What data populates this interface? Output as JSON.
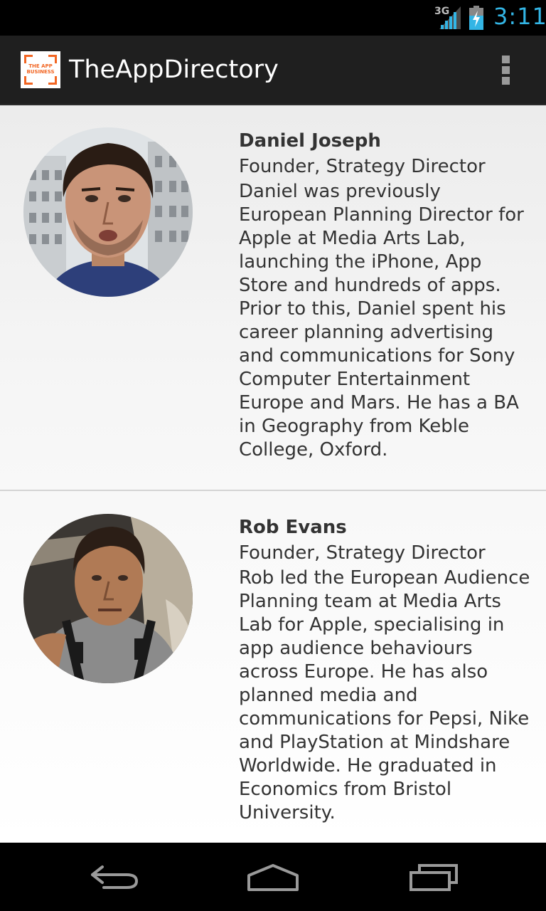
{
  "status_bar": {
    "network": "3G",
    "time": "3:11",
    "signal_icon": "signal-icon",
    "battery_icon": "battery-charging-icon",
    "accent_color": "#33b5e5"
  },
  "action_bar": {
    "app_icon_text": "THE APP BUSINESS",
    "title": "TheAppDirectory",
    "overflow_icon": "overflow-menu-icon"
  },
  "people": [
    {
      "name": "Daniel Joseph",
      "role": "Founder, Strategy Director",
      "bio": "Daniel was previously European Planning Director for Apple at Media Arts Lab, launching the iPhone, App Store and hundreds of apps. Prior to this, Daniel spent his career planning advertising and communications for Sony Computer Entertainment Europe and Mars. He has a BA in Geography from Keble College, Oxford."
    },
    {
      "name": "Rob Evans",
      "role": "Founder, Strategy Director",
      "bio": "Rob led the European Audience Planning team at Media Arts Lab for Apple, specialising in app audience behaviours across Europe. He has also planned media and communications for Pepsi, Nike and PlayStation at Mindshare Worldwide. He graduated in Economics from Bristol University."
    }
  ],
  "nav_bar": {
    "back_icon": "back-icon",
    "home_icon": "home-icon",
    "recents_icon": "recent-apps-icon"
  }
}
